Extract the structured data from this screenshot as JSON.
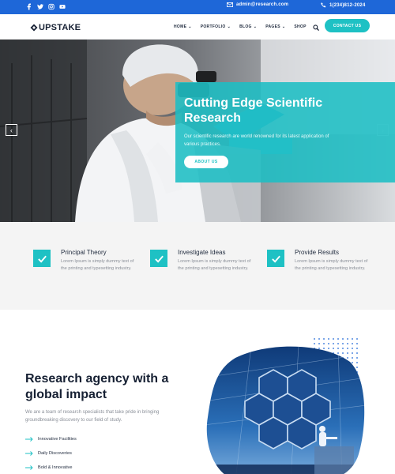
{
  "topbar": {
    "social_icons": [
      "facebook-icon",
      "twitter-icon",
      "instagram-icon",
      "youtube-icon"
    ],
    "email": "admin@research.com",
    "phone": "1(234)812-2024",
    "background": "#1e67d8"
  },
  "header": {
    "logo_text": "UPSTAKE",
    "nav": [
      {
        "label": "HOME",
        "has_dropdown": true
      },
      {
        "label": "PORTFOLIO",
        "has_dropdown": true
      },
      {
        "label": "BLOG",
        "has_dropdown": true
      },
      {
        "label": "PAGES",
        "has_dropdown": true
      },
      {
        "label": "SHOP",
        "has_dropdown": false
      }
    ],
    "cta_label": "CONTACT US"
  },
  "hero": {
    "title": "Cutting Edge Scientific Research",
    "text": "Our scientific research are world renowned for its latest application of various practices.",
    "button_label": "ABOUT US",
    "prev": "‹",
    "next": "›"
  },
  "features": [
    {
      "title": "Principal Theory",
      "text": "Lorem Ipsum is simply dummy text of the printing and typesetting industry."
    },
    {
      "title": "Investigate Ideas",
      "text": "Lorem Ipsum is simply dummy text of the printing and typesetting industry."
    },
    {
      "title": "Provide Results",
      "text": "Lorem Ipsum is simply dummy text of the printing and typesetting industry."
    }
  ],
  "about": {
    "title": "Research agency with a global impact",
    "text": "We are a team of research specialists that take pride in bringing groundbreaking discovery to our field of study.",
    "list": [
      "Innovative Facilities",
      "Daily Discoveries",
      "Bold & Innovative"
    ]
  },
  "colors": {
    "accent": "#1ec1c4",
    "primary_blue": "#1e67d8",
    "dark": "#162033"
  }
}
